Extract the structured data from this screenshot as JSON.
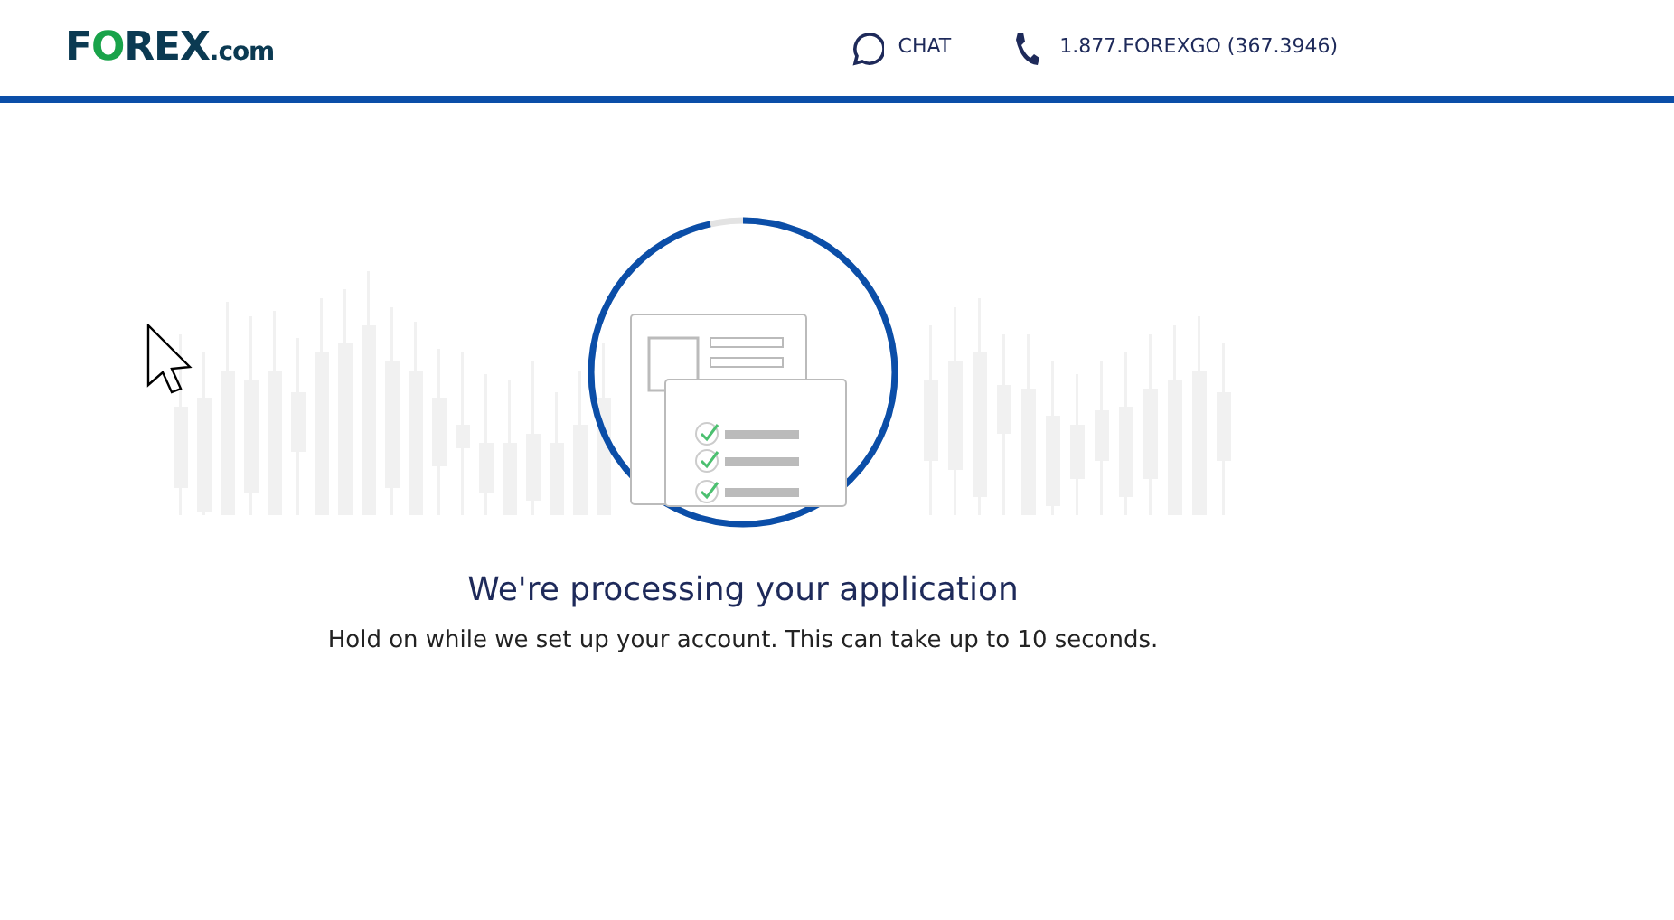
{
  "header": {
    "logo": {
      "start": "F",
      "mark": "O",
      "end": "REX",
      "suffix": ".com"
    },
    "chat": "CHAT",
    "phone": "1.877.FOREXGO (367.3946)"
  },
  "progress": {
    "level": 0.965
  },
  "title": "We're processing your application",
  "message": "Hold on while we set up your account. This can take up to 10 seconds."
}
